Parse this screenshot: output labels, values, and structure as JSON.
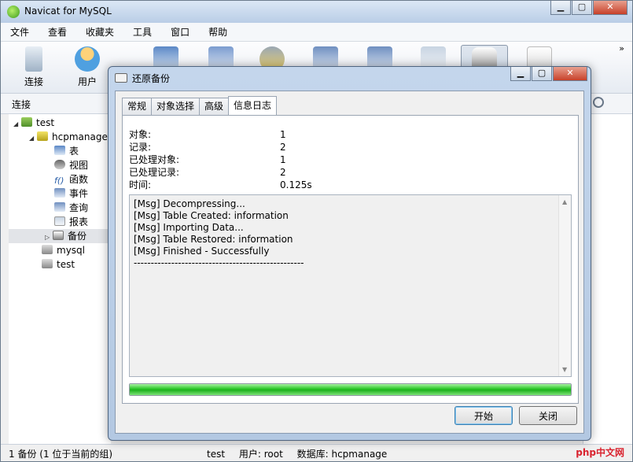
{
  "app": {
    "title": "Navicat for MySQL"
  },
  "menu": [
    "文件",
    "查看",
    "收藏夹",
    "工具",
    "窗口",
    "帮助"
  ],
  "toolbar": {
    "connect_label": "连接",
    "user_label": "用户",
    "more_glyph": "»"
  },
  "connection_bar": {
    "label": "连接"
  },
  "tree": {
    "items": [
      {
        "label": "test",
        "level": 0
      },
      {
        "label": "hcpmanage",
        "level": 1
      },
      {
        "label": "表",
        "level": 2
      },
      {
        "label": "视图",
        "level": 2
      },
      {
        "label": "函数",
        "level": 2
      },
      {
        "label": "事件",
        "level": 2
      },
      {
        "label": "查询",
        "level": 2
      },
      {
        "label": "报表",
        "level": 2
      },
      {
        "label": "备份",
        "level": 2
      },
      {
        "label": "mysql",
        "level": 1
      },
      {
        "label": "test",
        "level": 1
      }
    ]
  },
  "dialog": {
    "title": "还原备份",
    "tabs": [
      "常规",
      "对象选择",
      "高级",
      "信息日志"
    ],
    "active_tab": 3,
    "stats": [
      {
        "key": "对象:",
        "value": "1"
      },
      {
        "key": "记录:",
        "value": "2"
      },
      {
        "key": "已处理对象:",
        "value": "1"
      },
      {
        "key": "已处理记录:",
        "value": "2"
      },
      {
        "key": "时间:",
        "value": "0.125s"
      }
    ],
    "log": [
      "[Msg] Decompressing...",
      "[Msg] Table Created: information",
      "[Msg] Importing Data...",
      "[Msg] Table Restored: information",
      "[Msg] Finished - Successfully",
      "--------------------------------------------------"
    ],
    "progress_percent": 100,
    "start_button": "开始",
    "close_button": "关闭"
  },
  "statusbar": {
    "left": "1 备份 (1 位于当前的组)",
    "connection": "test",
    "user": "用户: root",
    "database": "数据库: hcpmanage",
    "watermark": "php中文网"
  },
  "colors": {
    "progress": "#27c424",
    "title_gradient": "#b9cde6"
  }
}
